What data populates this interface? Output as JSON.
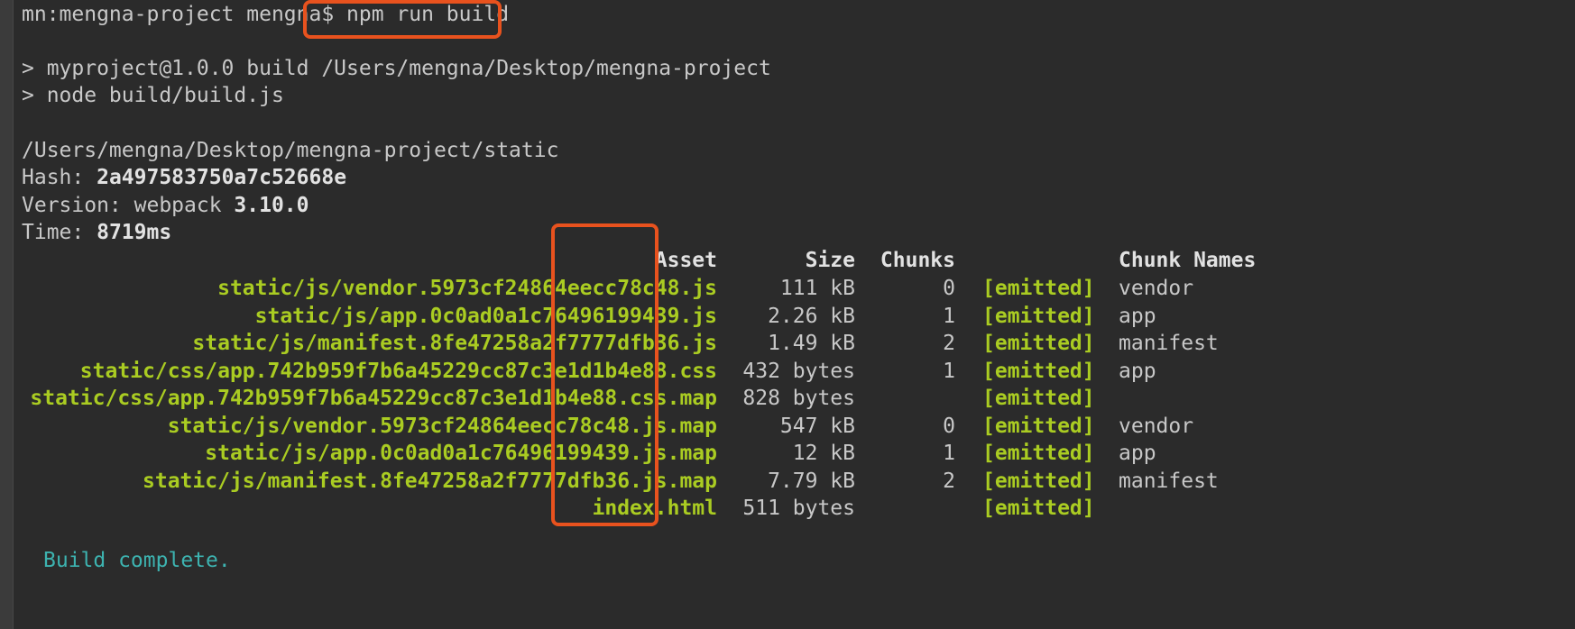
{
  "prompt": {
    "user_host": "mn:mengna-project mengna$ ",
    "command": "npm run build"
  },
  "script_lines": [
    "> myproject@1.0.0 build /Users/mengna/Desktop/mengna-project",
    "> node build/build.js"
  ],
  "output_path": "/Users/mengna/Desktop/mengna-project/static",
  "stats": {
    "hash_label": "Hash: ",
    "hash_value": "2a497583750a7c52668e",
    "version_label": "Version: webpack ",
    "version_value": "3.10.0",
    "time_label": "Time: ",
    "time_value": "8719ms"
  },
  "table": {
    "headers": {
      "asset": "Asset",
      "size": "Size",
      "chunks": "Chunks",
      "chunk_names": "Chunk Names"
    },
    "rows": [
      {
        "asset": "static/js/vendor.5973cf24864eecc78c48.js",
        "size": "111 kB",
        "chunks": "0",
        "emitted": "[emitted]",
        "name": "vendor"
      },
      {
        "asset": "static/js/app.0c0ad0a1c76496199439.js",
        "size": "2.26 kB",
        "chunks": "1",
        "emitted": "[emitted]",
        "name": "app"
      },
      {
        "asset": "static/js/manifest.8fe47258a2f7777dfb36.js",
        "size": "1.49 kB",
        "chunks": "2",
        "emitted": "[emitted]",
        "name": "manifest"
      },
      {
        "asset": "static/css/app.742b959f7b6a45229cc87c3e1d1b4e88.css",
        "size": "432 bytes",
        "chunks": "1",
        "emitted": "[emitted]",
        "name": "app"
      },
      {
        "asset": "static/css/app.742b959f7b6a45229cc87c3e1d1b4e88.css.map",
        "size": "828 bytes",
        "chunks": "",
        "emitted": "[emitted]",
        "name": ""
      },
      {
        "asset": "static/js/vendor.5973cf24864eecc78c48.js.map",
        "size": "547 kB",
        "chunks": "0",
        "emitted": "[emitted]",
        "name": "vendor"
      },
      {
        "asset": "static/js/app.0c0ad0a1c76496199439.js.map",
        "size": "12 kB",
        "chunks": "1",
        "emitted": "[emitted]",
        "name": "app"
      },
      {
        "asset": "static/js/manifest.8fe47258a2f7777dfb36.js.map",
        "size": "7.79 kB",
        "chunks": "2",
        "emitted": "[emitted]",
        "name": "manifest"
      },
      {
        "asset": "index.html",
        "size": "511 bytes",
        "chunks": "",
        "emitted": "[emitted]",
        "name": ""
      }
    ]
  },
  "footer": "Build complete."
}
